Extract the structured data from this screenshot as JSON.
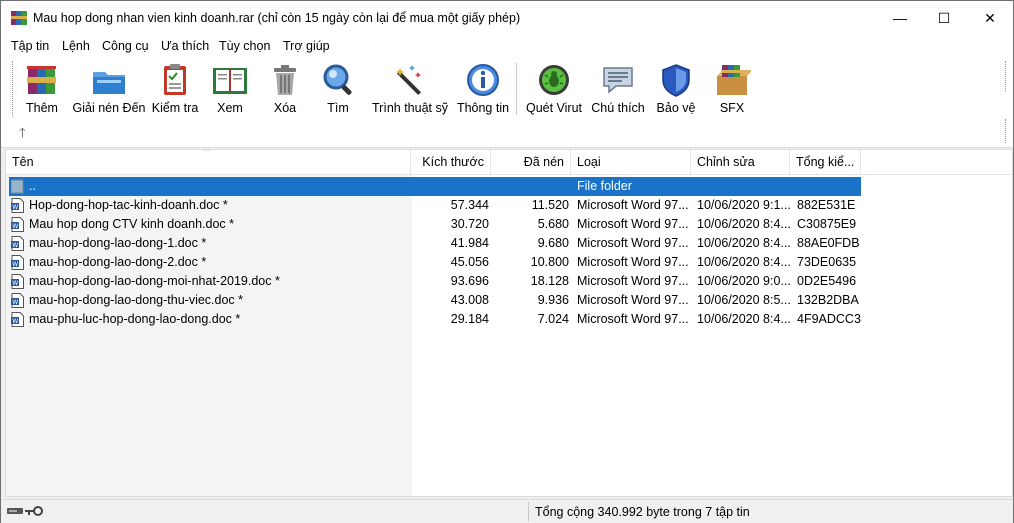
{
  "window": {
    "title": "Mau hop dong nhan vien kinh doanh.rar (chỉ còn 15 ngày còn lại để mua một giấy phép)",
    "minimize_glyph": "—",
    "maximize_glyph": "☐",
    "close_glyph": "✕"
  },
  "menu": [
    "Tập tin",
    "Lệnh",
    "Công cụ",
    "Ưa thích",
    "Tùy chọn",
    "Trợ giúp"
  ],
  "toolbar": {
    "buttons": [
      {
        "label": "Thêm",
        "icon": "archive-add-icon"
      },
      {
        "label": "Giải nén Đến",
        "icon": "extract-folder-icon"
      },
      {
        "label": "Kiểm tra",
        "icon": "test-clipboard-icon"
      },
      {
        "label": "Xem",
        "icon": "view-book-icon"
      },
      {
        "label": "Xóa",
        "icon": "trash-icon"
      },
      {
        "label": "Tìm",
        "icon": "magnifier-icon"
      },
      {
        "label": "Trình thuật sỹ",
        "icon": "wizard-wand-icon"
      },
      {
        "label": "Thông tin",
        "icon": "info-icon"
      },
      {
        "label": "Quét Virut",
        "icon": "virus-scan-icon"
      },
      {
        "label": "Chú thích",
        "icon": "comment-icon"
      },
      {
        "label": "Bảo vệ",
        "icon": "shield-icon"
      },
      {
        "label": "SFX",
        "icon": "sfx-box-icon"
      }
    ],
    "up_glyph": "🡑"
  },
  "columns": {
    "name": "Tên",
    "size": "Kích thước",
    "packed": "Đã nén",
    "type": "Loại",
    "modified": "Chỉnh sửa",
    "crc": "Tổng kiể..."
  },
  "parent_row": {
    "name": "..",
    "type": "File folder"
  },
  "files": [
    {
      "name": "Hop-dong-hop-tac-kinh-doanh.doc *",
      "size": "57.344",
      "packed": "11.520",
      "type": "Microsoft Word 97...",
      "modified": "10/06/2020 9:1...",
      "crc": "882E531E"
    },
    {
      "name": "Mau hop dong CTV kinh doanh.doc *",
      "size": "30.720",
      "packed": "5.680",
      "type": "Microsoft Word 97...",
      "modified": "10/06/2020 8:4...",
      "crc": "C30875E9"
    },
    {
      "name": "mau-hop-dong-lao-dong-1.doc *",
      "size": "41.984",
      "packed": "9.680",
      "type": "Microsoft Word 97...",
      "modified": "10/06/2020 8:4...",
      "crc": "88AE0FDB"
    },
    {
      "name": "mau-hop-dong-lao-dong-2.doc *",
      "size": "45.056",
      "packed": "10.800",
      "type": "Microsoft Word 97...",
      "modified": "10/06/2020 8:4...",
      "crc": "73DE0635"
    },
    {
      "name": "mau-hop-dong-lao-dong-moi-nhat-2019.doc *",
      "size": "93.696",
      "packed": "18.128",
      "type": "Microsoft Word 97...",
      "modified": "10/06/2020 9:0...",
      "crc": "0D2E5496"
    },
    {
      "name": "mau-hop-dong-lao-dong-thu-viec.doc *",
      "size": "43.008",
      "packed": "9.936",
      "type": "Microsoft Word 97...",
      "modified": "10/06/2020 8:5...",
      "crc": "132B2DBA"
    },
    {
      "name": "mau-phu-luc-hop-dong-lao-dong.doc *",
      "size": "29.184",
      "packed": "7.024",
      "type": "Microsoft Word 97...",
      "modified": "10/06/2020 8:4...",
      "crc": "4F9ADCC3"
    }
  ],
  "status": {
    "text": "Tổng cộng 340.992 byte trong 7 tập tin"
  }
}
